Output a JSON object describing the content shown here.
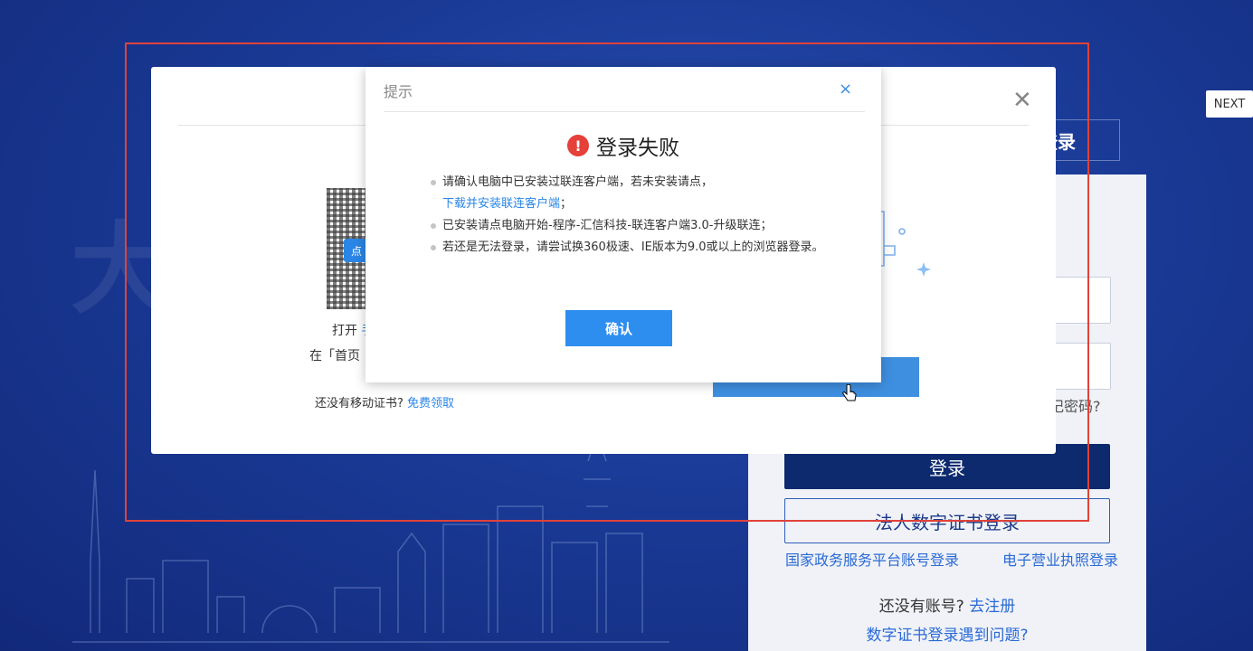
{
  "background": {
    "big_char": "大",
    "tab_label": "登录",
    "forgot_password": "记密码?",
    "login_button": "登录",
    "cert_login_button": "法人数字证书登录",
    "gov_login_link": "国家政务服务平台账号登录",
    "license_login_link": "电子营业执照登录",
    "register_prompt": "还没有账号?",
    "register_link": "去注册",
    "problem_link": "数字证书登录遇到问题?"
  },
  "next_button": "NEXT",
  "modal": {
    "qr_tag": "点",
    "open_text": "打开",
    "open_link": "手",
    "home_text": "在「首页",
    "no_cert_text": "还没有移动证书?",
    "no_cert_link": "免费领取"
  },
  "alert": {
    "title": "提示",
    "close": "×",
    "fail_icon": "!",
    "fail_title": "登录失败",
    "tip1_text": "请确认电脑中已安装过联连客户端，若未安装请点，",
    "tip1_link": "下载并安装联连客户端",
    "tip1_tail": "；",
    "tip2": "已安装请点电脑开始-程序-汇信科技-联连客户端3.0-升级联连；",
    "tip3": "若还是无法登录，请尝试换360极速、IE版本为9.0或以上的浏览器登录。",
    "confirm": "确认"
  },
  "colors": {
    "accent": "#2d8ef0",
    "error": "#e5403a",
    "highlight": "#e0423a"
  }
}
